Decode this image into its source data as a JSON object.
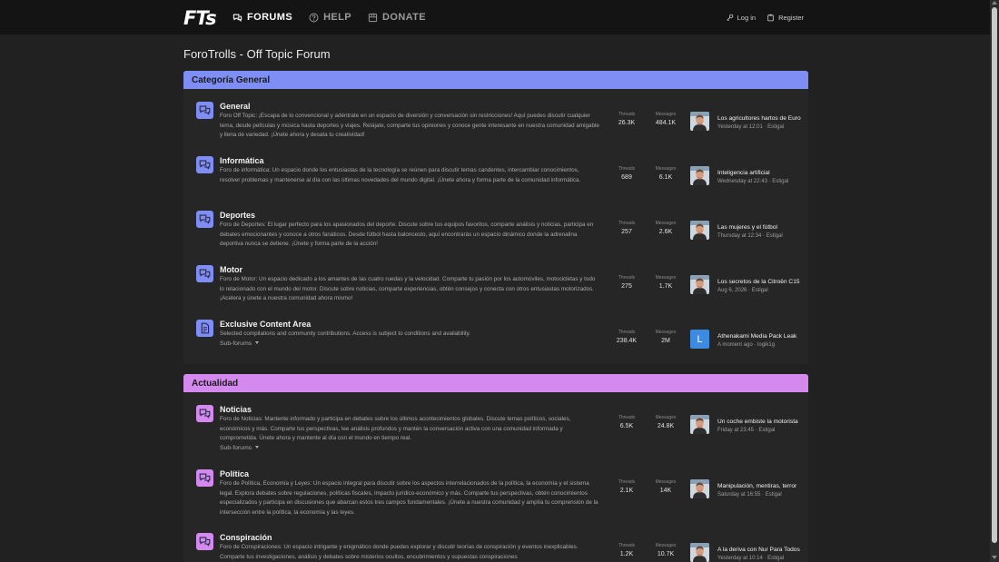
{
  "header": {
    "logo": "FTs",
    "nav": [
      {
        "label": "FORUMS",
        "icon": "chat-bubbles-icon",
        "active": true
      },
      {
        "label": "HELP",
        "icon": "help-circle-icon",
        "active": false
      },
      {
        "label": "DONATE",
        "icon": "donate-icon",
        "active": false
      }
    ],
    "login": "Log in",
    "register": "Register"
  },
  "page": {
    "title": "ForoTrolls - Off Topic Forum"
  },
  "categories": [
    {
      "title": "Categoría General",
      "color": "#7f8ef5",
      "forums": [
        {
          "title": "General",
          "description": "Foro Off Topic: ¡Escapa de lo convencional y adéntrate en un espacio de diversión y conversación sin restricciones! Aquí puedes discutir cualquier tema, desde películas y música hasta deportes y viajes. Relájate, comparte tus opiniones y conoce gente interesante en nuestra comunidad amigable y llena de variedad. ¡Únete ahora y desata tu creatividad!",
          "threads_label": "Threads",
          "threads": "26.3K",
          "messages_label": "Messages",
          "messages": "484.1K",
          "last_title": "Los agricultores hartos de Europa",
          "last_meta": "Yesterday at 12:01 · Estigal",
          "avatar": "man"
        },
        {
          "title": "Informática",
          "description": "Foro de informática: Un espacio donde los entusiastas de la tecnología se reúnen para discutir temas candentes, intercambiar conocimientos, resolver problemas y mantenerse al día con las últimas novedades del mundo digital. ¡Únete ahora y forma parte de la comunidad informática.",
          "threads_label": "Threads",
          "threads": "689",
          "messages_label": "Messages",
          "messages": "6.1K",
          "last_title": "Inteligencia artificial",
          "last_meta": "Wednesday at 22:43 · Estigal",
          "avatar": "man"
        },
        {
          "title": "Deportes",
          "description": "Foro de Deportes: El lugar perfecto para los apasionados del deporte. Discute sobre tus equipos favoritos, comparte análisis y noticias, participa en debates emocionantes y conoce a otros fanáticos. Desde fútbol hasta baloncesto, aquí encontrarás un espacio dinámico donde la adrenalina deportiva nunca se detiene. ¡Únete y forma parte de la acción!",
          "threads_label": "Threads",
          "threads": "257",
          "messages_label": "Messages",
          "messages": "2.6K",
          "last_title": "Las mujeres y el fútbol",
          "last_meta": "Thursday at 12:34 · Estigal",
          "avatar": "man"
        },
        {
          "title": "Motor",
          "description": "Foro de Motor: Un espacio dedicado a los amantes de las cuatro ruedas y la velocidad. Comparte tu pasión por los automóviles, motocicletas y todo lo relacionado con el mundo del motor. Discute sobre noticias, comparte experiencias, obtén consejos y conecta con otros entusiastas motorizados. ¡Acelera y únete a nuestra comunidad ahora mismo!",
          "threads_label": "Threads",
          "threads": "275",
          "messages_label": "Messages",
          "messages": "1.7K",
          "last_title": "Los secretos de la Citroën C15",
          "last_meta": "Aug 6, 2026 · Estigal",
          "avatar": "man"
        },
        {
          "title": "Exclusive Content Area",
          "description": "Selected compilations and community contributions. Access is subject to conditions and availability.",
          "subforums": "Sub-forums",
          "icon": "document-icon",
          "threads_label": "Threads",
          "threads": "238.4K",
          "messages_label": "Messages",
          "messages": "2M",
          "last_title": "Athenakami Media Pack Leak",
          "last_meta": "A moment ago · logik1g",
          "avatar": "letter",
          "avatar_letter": "L",
          "avatar_color": "#3d8be0"
        }
      ]
    },
    {
      "title": "Actualidad",
      "color": "#d389ee",
      "forums": [
        {
          "title": "Noticias",
          "description": "Foro de Noticias: Mantente informado y participa en debates sobre los últimos acontecimientos globales. Discute temas políticos, sociales, económicos y más. Comparte tus perspectivas, lee análisis profundos y mantén la conversación activa con una comunidad informada y comprometida. Únete ahora y mantente al día con el mundo en tiempo real.",
          "subforums": "Sub-forums",
          "threads_label": "Threads",
          "threads": "6.5K",
          "messages_label": "Messages",
          "messages": "24.8K",
          "last_title": "Un coche embiste la motorista",
          "last_meta": "Friday at 23:45 · Estigal",
          "avatar": "man"
        },
        {
          "title": "Política",
          "description": "Foro de Política, Economía y Leyes: Un espacio integral para discutir sobre los aspectos interrelacionados de la política, la economía y el sistema legal. Explora debates sobre regulaciones, políticas fiscales, impacto jurídico-económico y más. Comparte tus perspectivas, obtén conocimientos especializados y participa en discusiones que abarcan estos tres campos fundamentales. ¡Únete a nuestra comunidad y amplía tu comprensión de la intersección entre la política, la economía y las leyes.",
          "threads_label": "Threads",
          "threads": "2.1K",
          "messages_label": "Messages",
          "messages": "14K",
          "last_title": "Manipulación, mentiras, terror",
          "last_meta": "Saturday at 16:55 · Estigal",
          "avatar": "man"
        },
        {
          "title": "Conspiración",
          "description": "Foro de Conspiraciones: Un espacio intrigante y enigmático donde puedes explorar y discutir teorías de conspiración y eventos inexplicables. Comparte tus investigaciones, análisis y debates sobre misterios ocultos, encubrimientos y supuestas conspiraciones",
          "threads_label": "Threads",
          "threads": "1.2K",
          "messages_label": "Messages",
          "messages": "10.7K",
          "last_title": "A la deriva con Nur Para Todos",
          "last_meta": "Yesterday at 10:14 · Estigal",
          "avatar": "man"
        }
      ]
    }
  ]
}
